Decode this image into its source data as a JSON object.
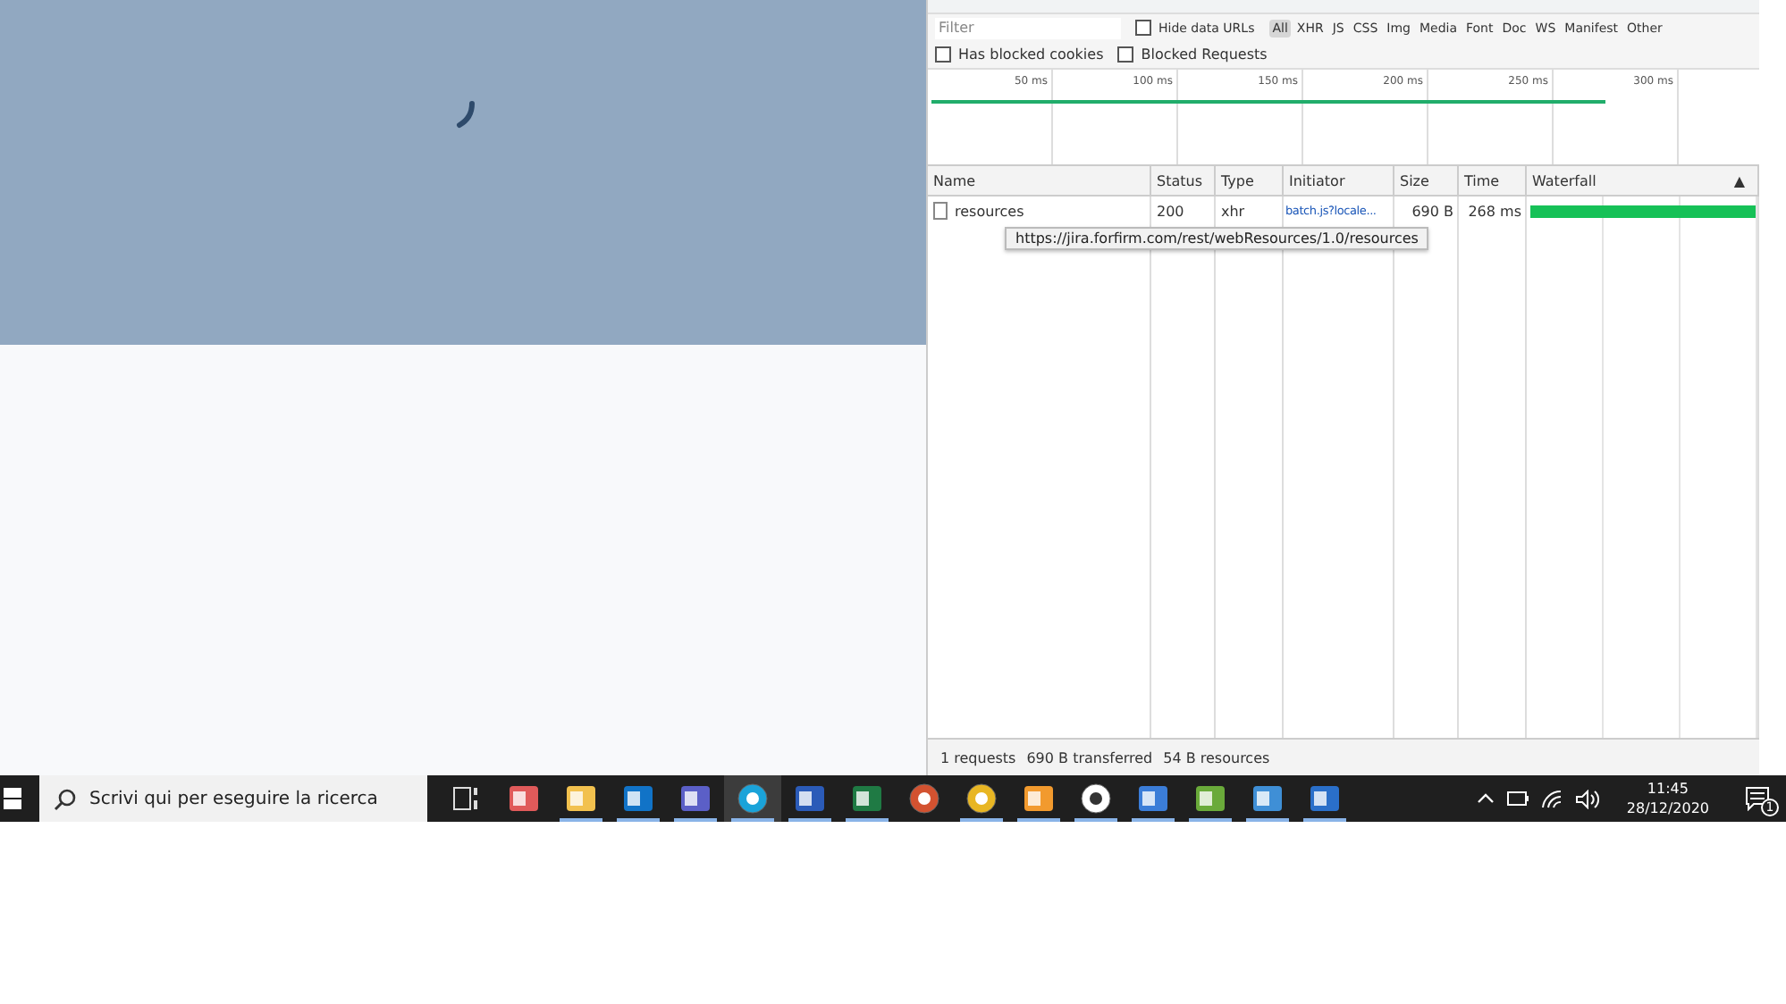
{
  "filter_bar": {
    "placeholder": "Filter",
    "hide_data_urls": {
      "label": "Hide data URLs",
      "checked": false
    },
    "types": [
      {
        "label": "All",
        "selected": true
      },
      {
        "label": "XHR",
        "selected": false
      },
      {
        "label": "JS",
        "selected": false
      },
      {
        "label": "CSS",
        "selected": false
      },
      {
        "label": "Img",
        "selected": false
      },
      {
        "label": "Media",
        "selected": false
      },
      {
        "label": "Font",
        "selected": false
      },
      {
        "label": "Doc",
        "selected": false
      },
      {
        "label": "WS",
        "selected": false
      },
      {
        "label": "Manifest",
        "selected": false
      },
      {
        "label": "Other",
        "selected": false
      }
    ],
    "options": [
      {
        "label": "Has blocked cookies",
        "checked": false
      },
      {
        "label": "Blocked Requests",
        "checked": false
      }
    ]
  },
  "overview": {
    "ticks": [
      "50 ms",
      "100 ms",
      "150 ms",
      "200 ms",
      "250 ms",
      "300 ms"
    ]
  },
  "table": {
    "columns": [
      {
        "label": "Name"
      },
      {
        "label": "Status"
      },
      {
        "label": "Type"
      },
      {
        "label": "Initiator"
      },
      {
        "label": "Size"
      },
      {
        "label": "Time"
      },
      {
        "label": "Waterfall",
        "sort_icon": "▲"
      }
    ],
    "rows": [
      {
        "name": "resources",
        "status": "200",
        "type": "xhr",
        "initiator": "batch.js?locale...",
        "size": "690 B",
        "time": "268 ms",
        "level": 1
      }
    ],
    "tooltip": "https://jira.forfirm.com/rest/webResources/1.0/resources"
  },
  "status_bar": {
    "requests": "1 requests",
    "transferred": "690 B transferred",
    "resources": "54 B resources"
  },
  "taskbar": {
    "search_placeholder": "Scrivi qui per eseguire la ricerca",
    "apps": [
      {
        "kind": "taskview",
        "running": false,
        "selected": false
      },
      {
        "kind": "paint",
        "running": false,
        "selected": false
      },
      {
        "kind": "folder",
        "running": true,
        "selected": false
      },
      {
        "kind": "outlook",
        "running": true,
        "selected": false
      },
      {
        "kind": "teams",
        "running": true,
        "selected": false
      },
      {
        "kind": "edge",
        "running": true,
        "selected": true
      },
      {
        "kind": "word",
        "running": true,
        "selected": false
      },
      {
        "kind": "excel",
        "running": true,
        "selected": false
      },
      {
        "kind": "powerpoint",
        "running": false,
        "selected": false
      },
      {
        "kind": "chrome",
        "running": true,
        "selected": false
      },
      {
        "kind": "rocket",
        "running": true,
        "selected": false
      },
      {
        "kind": "wcircle",
        "running": true,
        "selected": false
      },
      {
        "kind": "computer",
        "running": true,
        "selected": false
      },
      {
        "kind": "chart",
        "running": true,
        "selected": false
      },
      {
        "kind": "network",
        "running": true,
        "selected": false
      },
      {
        "kind": "screens",
        "running": true,
        "selected": false
      }
    ],
    "time": "11:45",
    "date": "28/12/2020",
    "notifications": "1"
  }
}
